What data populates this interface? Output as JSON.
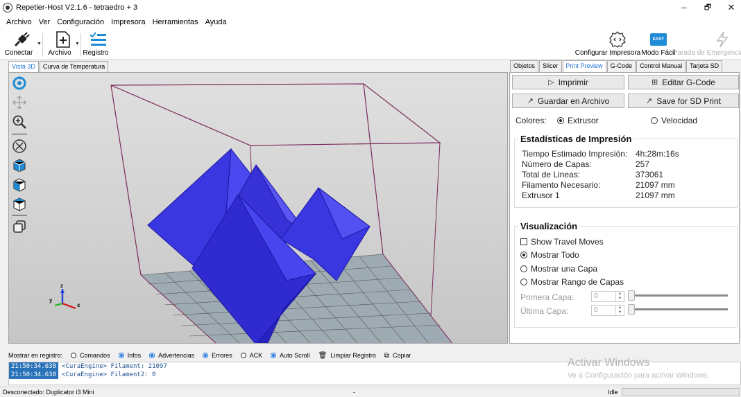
{
  "window": {
    "title": "Repetier-Host V2.1.6 - tetraedro + 3",
    "controls": {
      "minimize": "–",
      "maximize": "🗗",
      "close": "✕"
    }
  },
  "menu": [
    "Archivo",
    "Ver",
    "Configuración",
    "Impresora",
    "Herramientas",
    "Ayuda"
  ],
  "toolbar": {
    "connect_label": "Conectar",
    "file_label": "Archivo",
    "log_label": "Registro",
    "printer_config_label": "Configurar Impresora",
    "easy_mode_label": "Modo Fácil",
    "easy_badge": "EASY",
    "emergency_label": "Parada de Emergencia"
  },
  "left_tabs": [
    "Vista 3D",
    "Curva de Temperatura"
  ],
  "right_tabs": [
    "Objetos",
    "Slicer",
    "Print Preview",
    "G-Code",
    "Control Manual",
    "Tarjeta SD"
  ],
  "preview": {
    "print_btn": "Imprimir",
    "edit_gcode_btn": "Editar G-Code",
    "save_file_btn": "Guardar en Archivo",
    "save_sd_btn": "Save for SD Print",
    "colors_label": "Colores:",
    "color_extruder": "Extrusor",
    "color_speed": "Velocidad",
    "stats_title": "Estadísticas de Impresión",
    "stats": [
      {
        "label": "Tiempo Estimado Impresión:",
        "value": "4h:28m:16s"
      },
      {
        "label": "Número de Capas:",
        "value": "257"
      },
      {
        "label": "Total de Lineas:",
        "value": "373061"
      },
      {
        "label": "Filamento Necesario:",
        "value": "21097 mm"
      },
      {
        "label": "Extrusor 1",
        "value": "21097 mm"
      }
    ],
    "vis_title": "Visualización",
    "show_travel": "Show Travel Moves",
    "show_all": "Mostrar Todo",
    "show_one": "Mostrar una Capa",
    "show_range": "Mostrar Rango de Capas",
    "first_layer_label": "Primera Capa:",
    "last_layer_label": "Última Capa:",
    "first_layer_value": "0",
    "last_layer_value": "0"
  },
  "log": {
    "show_label": "Mostrar en registro:",
    "options": [
      "Comandos",
      "Infos",
      "Advertencias",
      "Errores",
      "ACK",
      "Auto Scroll"
    ],
    "options_on": [
      false,
      true,
      true,
      true,
      false,
      true
    ],
    "clear_label": "Limpiar Registro",
    "copy_label": "Copiar",
    "lines": [
      {
        "ts": "21:50:34.638",
        "msg": "<CuraEngine> Filament: 21097"
      },
      {
        "ts": "21:50:34.638",
        "msg": "<CuraEngine> Filament2: 0"
      }
    ]
  },
  "watermark": {
    "title": "Activar Windows",
    "subtitle": "Ve a Configuración para activar Windows."
  },
  "status": {
    "connection": "Desconectado: Duplicator i3 Mini",
    "middle": "-",
    "state": "Idle"
  },
  "colors": {
    "accent": "#1e73d8",
    "model": "#3a36e0",
    "bed": "#9fabb3"
  }
}
